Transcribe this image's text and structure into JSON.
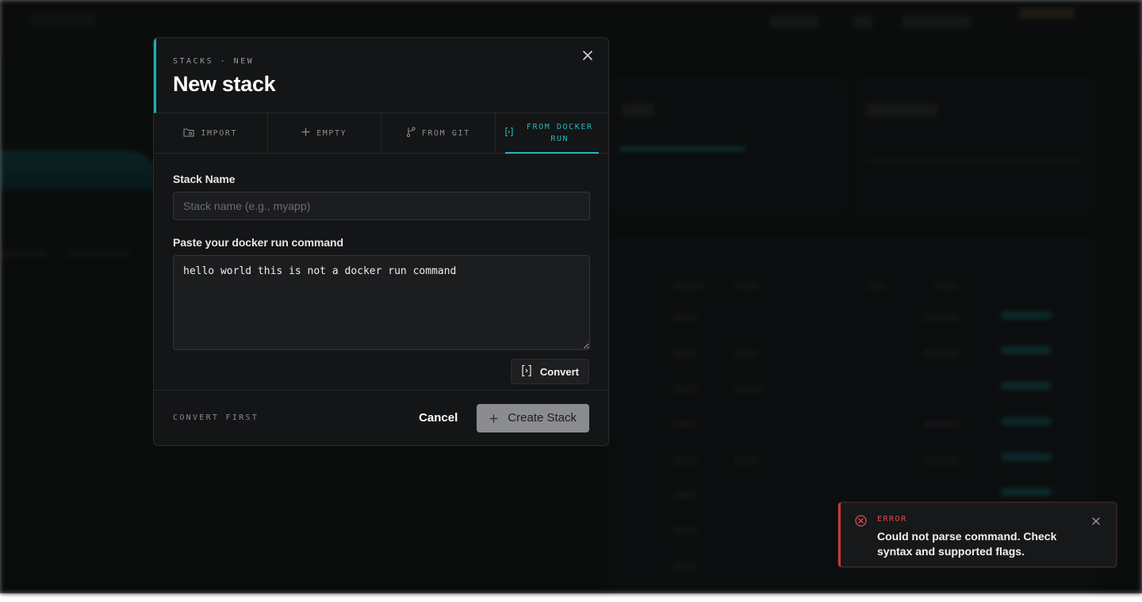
{
  "modal": {
    "eyebrow": "STACKS · NEW",
    "title": "New stack",
    "close_icon": "close-icon"
  },
  "tabs": [
    {
      "label": "IMPORT",
      "icon": "folder-import-icon",
      "active": false
    },
    {
      "label": "EMPTY",
      "icon": "plus-icon",
      "active": false
    },
    {
      "label": "FROM GIT",
      "icon": "git-branch-icon",
      "active": false
    },
    {
      "label": "FROM DOCKER RUN",
      "icon": "convert-icon",
      "active": true
    }
  ],
  "form": {
    "stack_name_label": "Stack Name",
    "stack_name_value": "",
    "stack_name_placeholder": "Stack name (e.g., myapp)",
    "command_label": "Paste your docker run command",
    "command_value": "hello world this is not a docker run command",
    "convert_label": "Convert"
  },
  "footer": {
    "hint": "CONVERT FIRST",
    "cancel_label": "Cancel",
    "create_label": "Create Stack"
  },
  "toast": {
    "label": "ERROR",
    "message": "Could not parse command. Check syntax and supported flags."
  },
  "colors": {
    "accent": "#23b8bc",
    "error": "#e0484c",
    "modal_bg": "#141516"
  }
}
